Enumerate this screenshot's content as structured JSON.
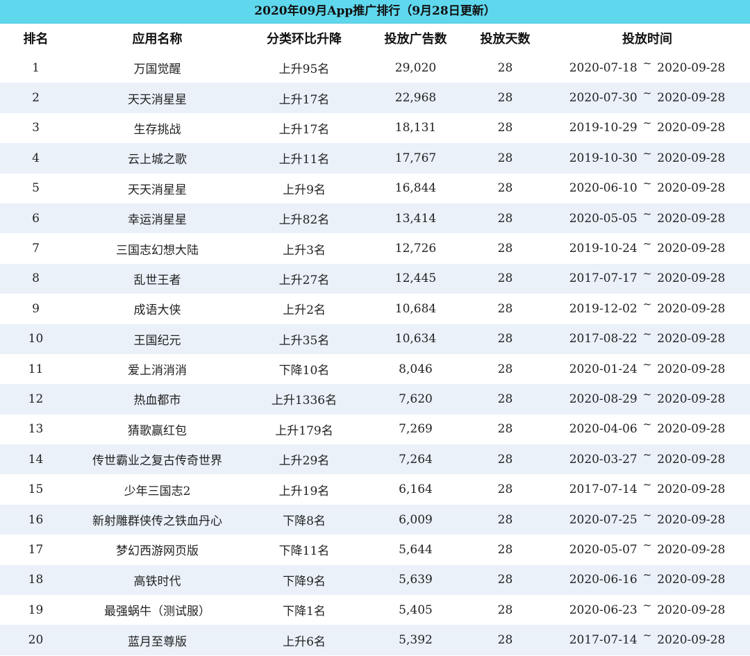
{
  "title": "2020年09月App推广排行（9月28日更新）",
  "headers": {
    "rank": "排名",
    "name": "应用名称",
    "change": "分类环比升降",
    "ads": "投放广告数",
    "days": "投放天数",
    "time": "投放时间"
  },
  "range_separator": "~",
  "rows": [
    {
      "rank": "1",
      "name": "万国觉醒",
      "change": "上升95名",
      "ads": "29,020",
      "days": "28",
      "start": "2020-07-18",
      "end": "2020-09-28"
    },
    {
      "rank": "2",
      "name": "天天消星星",
      "change": "上升17名",
      "ads": "22,968",
      "days": "28",
      "start": "2020-07-30",
      "end": "2020-09-28"
    },
    {
      "rank": "3",
      "name": "生存挑战",
      "change": "上升17名",
      "ads": "18,131",
      "days": "28",
      "start": "2019-10-29",
      "end": "2020-09-28"
    },
    {
      "rank": "4",
      "name": "云上城之歌",
      "change": "上升11名",
      "ads": "17,767",
      "days": "28",
      "start": "2019-10-30",
      "end": "2020-09-28"
    },
    {
      "rank": "5",
      "name": "天天消星星",
      "change": "上升9名",
      "ads": "16,844",
      "days": "28",
      "start": "2020-06-10",
      "end": "2020-09-28"
    },
    {
      "rank": "6",
      "name": "幸运消星星",
      "change": "上升82名",
      "ads": "13,414",
      "days": "28",
      "start": "2020-05-05",
      "end": "2020-09-28"
    },
    {
      "rank": "7",
      "name": "三国志幻想大陆",
      "change": "上升3名",
      "ads": "12,726",
      "days": "28",
      "start": "2019-10-24",
      "end": "2020-09-28"
    },
    {
      "rank": "8",
      "name": "乱世王者",
      "change": "上升27名",
      "ads": "12,445",
      "days": "28",
      "start": "2017-07-17",
      "end": "2020-09-28"
    },
    {
      "rank": "9",
      "name": "成语大侠",
      "change": "上升2名",
      "ads": "10,684",
      "days": "28",
      "start": "2019-12-02",
      "end": "2020-09-28"
    },
    {
      "rank": "10",
      "name": "王国纪元",
      "change": "上升35名",
      "ads": "10,634",
      "days": "28",
      "start": "2017-08-22",
      "end": "2020-09-28"
    },
    {
      "rank": "11",
      "name": "爱上消消消",
      "change": "下降10名",
      "ads": "8,046",
      "days": "28",
      "start": "2020-01-24",
      "end": "2020-09-28"
    },
    {
      "rank": "12",
      "name": "热血都市",
      "change": "上升1336名",
      "ads": "7,620",
      "days": "28",
      "start": "2020-08-29",
      "end": "2020-09-28"
    },
    {
      "rank": "13",
      "name": "猜歌赢红包",
      "change": "上升179名",
      "ads": "7,269",
      "days": "28",
      "start": "2020-04-06",
      "end": "2020-09-28"
    },
    {
      "rank": "14",
      "name": "传世霸业之复古传奇世界",
      "change": "上升29名",
      "ads": "7,264",
      "days": "28",
      "start": "2020-03-27",
      "end": "2020-09-28"
    },
    {
      "rank": "15",
      "name": "少年三国志2",
      "change": "上升19名",
      "ads": "6,164",
      "days": "28",
      "start": "2017-07-14",
      "end": "2020-09-28"
    },
    {
      "rank": "16",
      "name": "新射雕群侠传之铁血丹心",
      "change": "下降8名",
      "ads": "6,009",
      "days": "28",
      "start": "2020-07-25",
      "end": "2020-09-28"
    },
    {
      "rank": "17",
      "name": "梦幻西游网页版",
      "change": "下降11名",
      "ads": "5,644",
      "days": "28",
      "start": "2020-05-07",
      "end": "2020-09-28"
    },
    {
      "rank": "18",
      "name": "高铁时代",
      "change": "下降9名",
      "ads": "5,639",
      "days": "28",
      "start": "2020-06-16",
      "end": "2020-09-28"
    },
    {
      "rank": "19",
      "name": "最强蜗牛（测试服）",
      "change": "下降1名",
      "ads": "5,405",
      "days": "28",
      "start": "2020-06-23",
      "end": "2020-09-28"
    },
    {
      "rank": "20",
      "name": "蓝月至尊版",
      "change": "上升6名",
      "ads": "5,392",
      "days": "28",
      "start": "2017-07-14",
      "end": "2020-09-28"
    }
  ],
  "colors": {
    "title_bar": "#5fd8ee",
    "row_stripe": "#eaf1f9",
    "row_plain": "#ffffff"
  }
}
